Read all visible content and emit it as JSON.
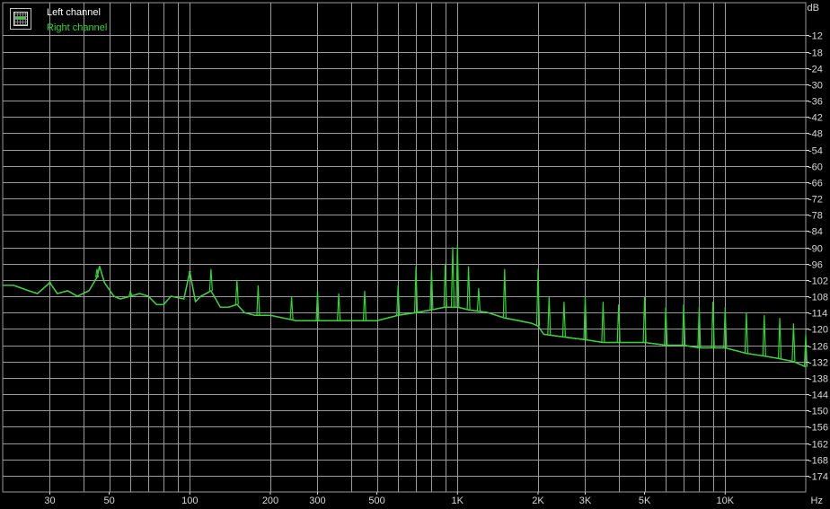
{
  "chart_data": {
    "type": "line",
    "title": "",
    "xlabel": "Hz",
    "ylabel": "dB",
    "x_scale": "log",
    "xlim": [
      20,
      20000
    ],
    "ylim": [
      -180,
      0
    ],
    "grid": true,
    "legend_position": "top-left",
    "x_ticks": [
      {
        "value": 30,
        "label": "30"
      },
      {
        "value": 50,
        "label": "50"
      },
      {
        "value": 100,
        "label": "100"
      },
      {
        "value": 200,
        "label": "200"
      },
      {
        "value": 300,
        "label": "300"
      },
      {
        "value": 500,
        "label": "500"
      },
      {
        "value": 1000,
        "label": "1K"
      },
      {
        "value": 2000,
        "label": "2K"
      },
      {
        "value": 3000,
        "label": "3K"
      },
      {
        "value": 5000,
        "label": "5K"
      },
      {
        "value": 10000,
        "label": "10K"
      }
    ],
    "y_ticks": [
      {
        "value": -12,
        "label": "-12"
      },
      {
        "value": -18,
        "label": "-18"
      },
      {
        "value": -24,
        "label": "-24"
      },
      {
        "value": -30,
        "label": "-30"
      },
      {
        "value": -36,
        "label": "-36"
      },
      {
        "value": -42,
        "label": "-42"
      },
      {
        "value": -48,
        "label": "-48"
      },
      {
        "value": -54,
        "label": "-54"
      },
      {
        "value": -60,
        "label": "-60"
      },
      {
        "value": -66,
        "label": "-66"
      },
      {
        "value": -72,
        "label": "-72"
      },
      {
        "value": -78,
        "label": "-78"
      },
      {
        "value": -84,
        "label": "-84"
      },
      {
        "value": -90,
        "label": "-90"
      },
      {
        "value": -96,
        "label": "-96"
      },
      {
        "value": -102,
        "label": "-102"
      },
      {
        "value": -108,
        "label": "-108"
      },
      {
        "value": -114,
        "label": "-114"
      },
      {
        "value": -120,
        "label": "-120"
      },
      {
        "value": -126,
        "label": "-126"
      },
      {
        "value": -132,
        "label": "-132"
      },
      {
        "value": -138,
        "label": "-138"
      },
      {
        "value": -144,
        "label": "-144"
      },
      {
        "value": -150,
        "label": "-150"
      },
      {
        "value": -156,
        "label": "-156"
      },
      {
        "value": -162,
        "label": "-162"
      },
      {
        "value": -168,
        "label": "-168"
      },
      {
        "value": -174,
        "label": "-174"
      }
    ],
    "series": [
      {
        "name": "Left channel",
        "color": "#ffffff",
        "points": [
          [
            20,
            -104
          ],
          [
            22,
            -104
          ],
          [
            25,
            -106
          ],
          [
            27,
            -107
          ],
          [
            30,
            -103
          ],
          [
            32,
            -107
          ],
          [
            35,
            -106
          ],
          [
            38,
            -108
          ],
          [
            42,
            -106
          ],
          [
            45,
            -101
          ],
          [
            46,
            -97
          ],
          [
            48,
            -103
          ],
          [
            52,
            -108
          ],
          [
            55,
            -109
          ],
          [
            60,
            -108
          ],
          [
            65,
            -107
          ],
          [
            70,
            -108
          ],
          [
            75,
            -111
          ],
          [
            80,
            -111
          ],
          [
            85,
            -108
          ],
          [
            95,
            -109
          ],
          [
            100,
            -99
          ],
          [
            105,
            -110
          ],
          [
            110,
            -108
          ],
          [
            115,
            -107
          ],
          [
            120,
            -106
          ],
          [
            130,
            -112
          ],
          [
            140,
            -112
          ],
          [
            150,
            -111
          ],
          [
            160,
            -114
          ],
          [
            175,
            -115
          ],
          [
            200,
            -115
          ],
          [
            250,
            -117
          ],
          [
            300,
            -117
          ],
          [
            400,
            -117
          ],
          [
            500,
            -117
          ],
          [
            600,
            -115
          ],
          [
            700,
            -114
          ],
          [
            800,
            -113
          ],
          [
            900,
            -112
          ],
          [
            1000,
            -112
          ],
          [
            1100,
            -113
          ],
          [
            1300,
            -114
          ],
          [
            1500,
            -116
          ],
          [
            1700,
            -117
          ],
          [
            1900,
            -118
          ],
          [
            2000,
            -119
          ],
          [
            2100,
            -122
          ],
          [
            2500,
            -123
          ],
          [
            3000,
            -124
          ],
          [
            3500,
            -125
          ],
          [
            4000,
            -125
          ],
          [
            5000,
            -125
          ],
          [
            6000,
            -126
          ],
          [
            7000,
            -126
          ],
          [
            8000,
            -127
          ],
          [
            9000,
            -127
          ],
          [
            10000,
            -127
          ],
          [
            12000,
            -129
          ],
          [
            14000,
            -130
          ],
          [
            16000,
            -131
          ],
          [
            18000,
            -132
          ],
          [
            20000,
            -134
          ]
        ]
      },
      {
        "name": "Right channel",
        "color": "#2bd82b",
        "points": [
          [
            20,
            -104
          ],
          [
            22,
            -104
          ],
          [
            25,
            -106
          ],
          [
            27,
            -107
          ],
          [
            30,
            -103
          ],
          [
            32,
            -107
          ],
          [
            35,
            -106
          ],
          [
            38,
            -108
          ],
          [
            42,
            -106
          ],
          [
            45,
            -101
          ],
          [
            46,
            -97
          ],
          [
            48,
            -103
          ],
          [
            52,
            -108
          ],
          [
            55,
            -109
          ],
          [
            60,
            -108
          ],
          [
            65,
            -107
          ],
          [
            70,
            -108
          ],
          [
            75,
            -111
          ],
          [
            80,
            -111
          ],
          [
            85,
            -108
          ],
          [
            95,
            -109
          ],
          [
            100,
            -99
          ],
          [
            105,
            -110
          ],
          [
            110,
            -108
          ],
          [
            115,
            -107
          ],
          [
            120,
            -106
          ],
          [
            130,
            -112
          ],
          [
            140,
            -112
          ],
          [
            150,
            -111
          ],
          [
            160,
            -114
          ],
          [
            175,
            -115
          ],
          [
            200,
            -115
          ],
          [
            250,
            -117
          ],
          [
            300,
            -117
          ],
          [
            400,
            -117
          ],
          [
            500,
            -117
          ],
          [
            600,
            -115
          ],
          [
            700,
            -114
          ],
          [
            800,
            -113
          ],
          [
            900,
            -112
          ],
          [
            1000,
            -112
          ],
          [
            1100,
            -113
          ],
          [
            1300,
            -114
          ],
          [
            1500,
            -116
          ],
          [
            1700,
            -117
          ],
          [
            1900,
            -118
          ],
          [
            2000,
            -119
          ],
          [
            2100,
            -122
          ],
          [
            2500,
            -123
          ],
          [
            3000,
            -124
          ],
          [
            3500,
            -125
          ],
          [
            4000,
            -125
          ],
          [
            5000,
            -125
          ],
          [
            6000,
            -126
          ],
          [
            7000,
            -126
          ],
          [
            8000,
            -127
          ],
          [
            9000,
            -127
          ],
          [
            10000,
            -127
          ],
          [
            12000,
            -129
          ],
          [
            14000,
            -130
          ],
          [
            16000,
            -131
          ],
          [
            18000,
            -132
          ],
          [
            20000,
            -134
          ]
        ],
        "peaks": [
          {
            "x": 30,
            "y": -103
          },
          {
            "x": 45,
            "y": -98
          },
          {
            "x": 60,
            "y": -106
          },
          {
            "x": 100,
            "y": -99
          },
          {
            "x": 120,
            "y": -98
          },
          {
            "x": 150,
            "y": -102
          },
          {
            "x": 180,
            "y": -104
          },
          {
            "x": 240,
            "y": -108
          },
          {
            "x": 300,
            "y": -106
          },
          {
            "x": 360,
            "y": -107
          },
          {
            "x": 450,
            "y": -106
          },
          {
            "x": 600,
            "y": -104
          },
          {
            "x": 700,
            "y": -97
          },
          {
            "x": 800,
            "y": -98
          },
          {
            "x": 900,
            "y": -96
          },
          {
            "x": 960,
            "y": -90
          },
          {
            "x": 1000,
            "y": -89
          },
          {
            "x": 1100,
            "y": -97
          },
          {
            "x": 1200,
            "y": -105
          },
          {
            "x": 1500,
            "y": -98
          },
          {
            "x": 2000,
            "y": -98
          },
          {
            "x": 2200,
            "y": -108
          },
          {
            "x": 2500,
            "y": -110
          },
          {
            "x": 3000,
            "y": -108
          },
          {
            "x": 3500,
            "y": -110
          },
          {
            "x": 4000,
            "y": -111
          },
          {
            "x": 5000,
            "y": -108
          },
          {
            "x": 6000,
            "y": -112
          },
          {
            "x": 7000,
            "y": -111
          },
          {
            "x": 8000,
            "y": -112
          },
          {
            "x": 9000,
            "y": -110
          },
          {
            "x": 10000,
            "y": -112
          },
          {
            "x": 12000,
            "y": -114
          },
          {
            "x": 14000,
            "y": -115
          },
          {
            "x": 16000,
            "y": -116
          },
          {
            "x": 18000,
            "y": -118
          },
          {
            "x": 20000,
            "y": -122
          }
        ]
      }
    ]
  },
  "axis": {
    "y_unit": "dB",
    "x_unit": "Hz"
  },
  "legend": {
    "items": [
      {
        "label": "Left channel",
        "color": "#ffffff"
      },
      {
        "label": "Right channel",
        "color": "#2bd82b"
      }
    ]
  }
}
